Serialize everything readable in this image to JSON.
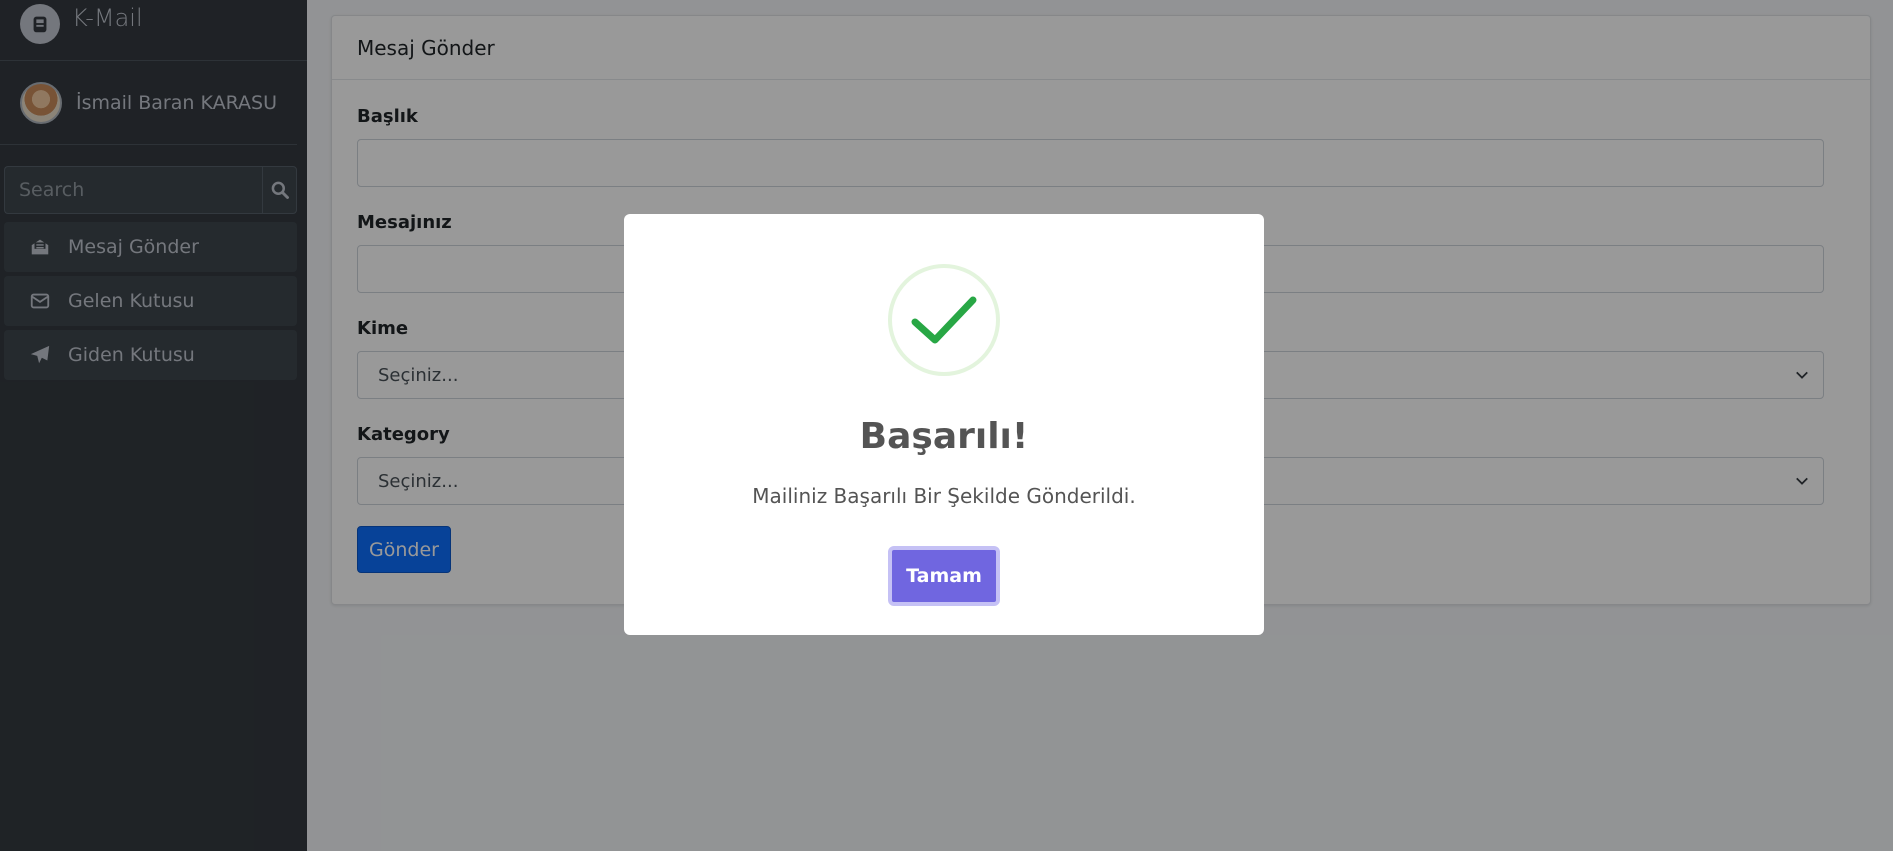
{
  "app": {
    "brand": "K-Mail"
  },
  "user": {
    "name": "İsmail Baran KARASU"
  },
  "search": {
    "placeholder": "Search"
  },
  "sidebar": {
    "items": [
      {
        "label": "Mesaj Gönder",
        "icon": "envelope-open-icon"
      },
      {
        "label": "Gelen Kutusu",
        "icon": "envelope-icon"
      },
      {
        "label": "Giden Kutusu",
        "icon": "paper-plane-icon"
      }
    ]
  },
  "card": {
    "title": "Mesaj Gönder",
    "fields": {
      "baslik": {
        "label": "Başlık",
        "value": ""
      },
      "mesaj": {
        "label": "Mesajınız",
        "value": ""
      },
      "kime": {
        "label": "Kime",
        "selected": "Seçiniz..."
      },
      "kategory": {
        "label": "Kategory",
        "selected": "Seçiniz..."
      }
    },
    "submit_label": "Gönder"
  },
  "modal": {
    "title": "Başarılı!",
    "text": "Mailiniz Başarılı Bir Şekilde Gönderildi.",
    "confirm_label": "Tamam",
    "icon": "checkmark-icon"
  },
  "colors": {
    "sidebar_bg": "#343a40",
    "primary": "#0d6efd",
    "confirm": "#7066e0",
    "success": "#28a745"
  }
}
